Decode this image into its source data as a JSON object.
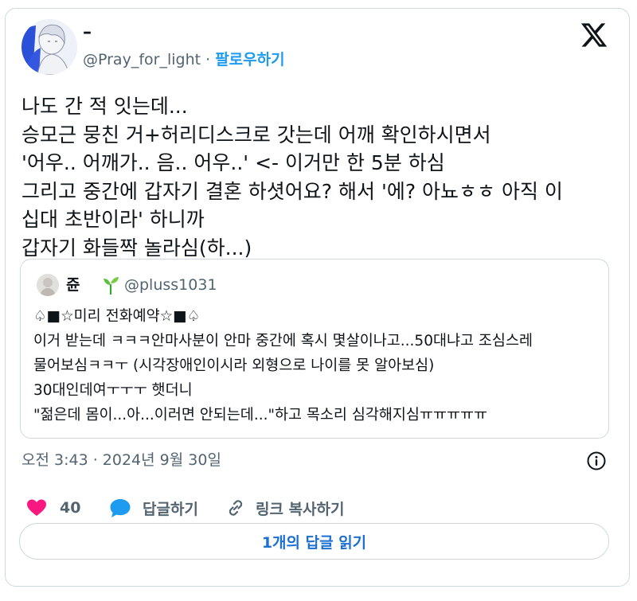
{
  "colors": {
    "accent": "#1d9bf0",
    "like": "#f91880",
    "reply": "#1d9bf0",
    "secondary_text": "#536471",
    "border": "#cfd9de"
  },
  "header": {
    "display_name": "–",
    "handle": "@Pray_for_light",
    "separator": " · ",
    "follow": "팔로우하기",
    "logo_icon": "x-logo-icon"
  },
  "tweet": {
    "lines": [
      "나도 간 적 잇는데...",
      "승모근 뭉친 거+허리디스크로 갓는데 어깨 확인하시면서",
      "'어우.. 어깨가.. 음.. 어우..' <- 이거만 한 5분 하심",
      "그리고 중간에 갑자기 결혼 하셧어요? 해서 '에? 아뇨ㅎㅎ 아직 이",
      "십대 초반이라' 하니까",
      "갑자기 화들짝 놀라심(하...)"
    ]
  },
  "quote": {
    "display_name": "쥰",
    "handle": "@pluss1031",
    "lines": [
      "♤■☆미리 전화예약☆■♤",
      "이거 받는데 ㅋㅋㅋ안마사분이 안마 중간에 혹시 몇살이나고...50대냐고 조심스레",
      "물어보심ㅋㅋㅜ (시각장애인이시라 외형으로  나이를 못 알아보심)",
      "30대인데여ㅜㅜㅜ 햇더니",
      "\"젊은데 몸이...아...이러면 안되는데...\"하고 목소리 심각해지심ㅠㅠㅠㅠㅠ"
    ]
  },
  "meta": {
    "timestamp": "오전 3:43 · 2024년 9월 30일"
  },
  "actions": {
    "like_count": "40",
    "reply_label": "답글하기",
    "copy_link_label": "링크 복사하기"
  },
  "read_replies": "1개의 답글 읽기"
}
